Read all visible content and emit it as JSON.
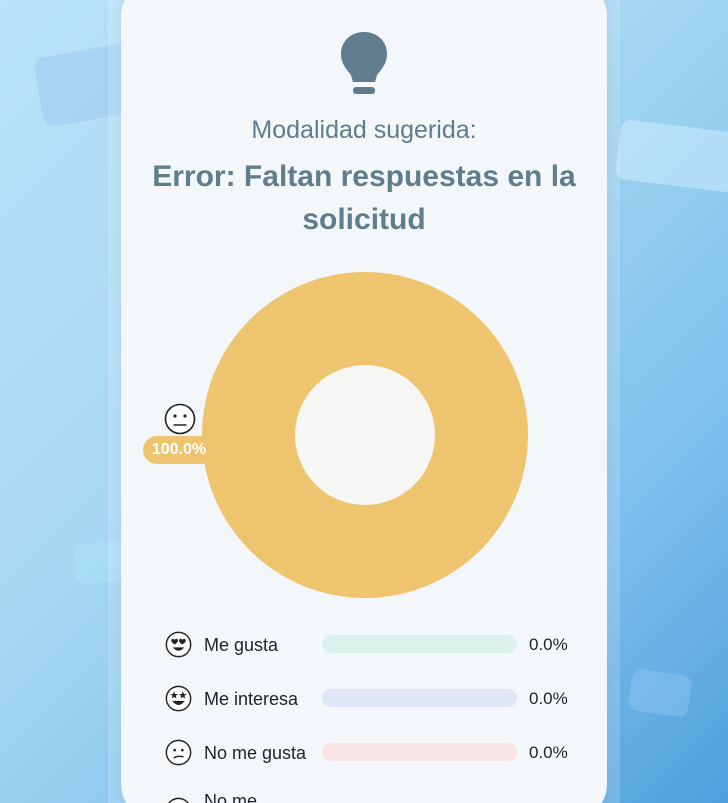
{
  "header": {
    "icon": "lightbulb-icon",
    "subtitle": "Modalidad sugerida:",
    "error": "Error: Faltan respuestas en la solicitud"
  },
  "chart_data": {
    "type": "pie",
    "categories": [
      "Me gusta",
      "Me interesa",
      "No me gusta",
      "No me ..."
    ],
    "values": [
      0.0,
      0.0,
      0.0,
      100.0
    ],
    "colors": [
      "#d9f3ec",
      "#dfe7f8",
      "#f8e4e4",
      "#efc46e"
    ],
    "slice_label": "100.0%",
    "slice_icon": "neutral-face-icon"
  },
  "legend": [
    {
      "label": "Me gusta",
      "value": "0.0%",
      "fraction": 0.0,
      "icon": "heart-eyes-face-icon",
      "color": "#d9f3ec",
      "fill": "#7fd1b9"
    },
    {
      "label": "Me interesa",
      "value": "0.0%",
      "fraction": 0.0,
      "icon": "star-struck-face-icon",
      "color": "#dfe7f8",
      "fill": "#8ea7e6"
    },
    {
      "label": "No me gusta",
      "value": "0.0%",
      "fraction": 0.0,
      "icon": "confused-face-icon",
      "color": "#f8e4e4",
      "fill": "#e69a9a"
    },
    {
      "label": "No me",
      "value": "",
      "fraction": null,
      "icon": "neutral-face-icon",
      "color": "#efc46e",
      "fill": "#efc46e"
    }
  ]
}
